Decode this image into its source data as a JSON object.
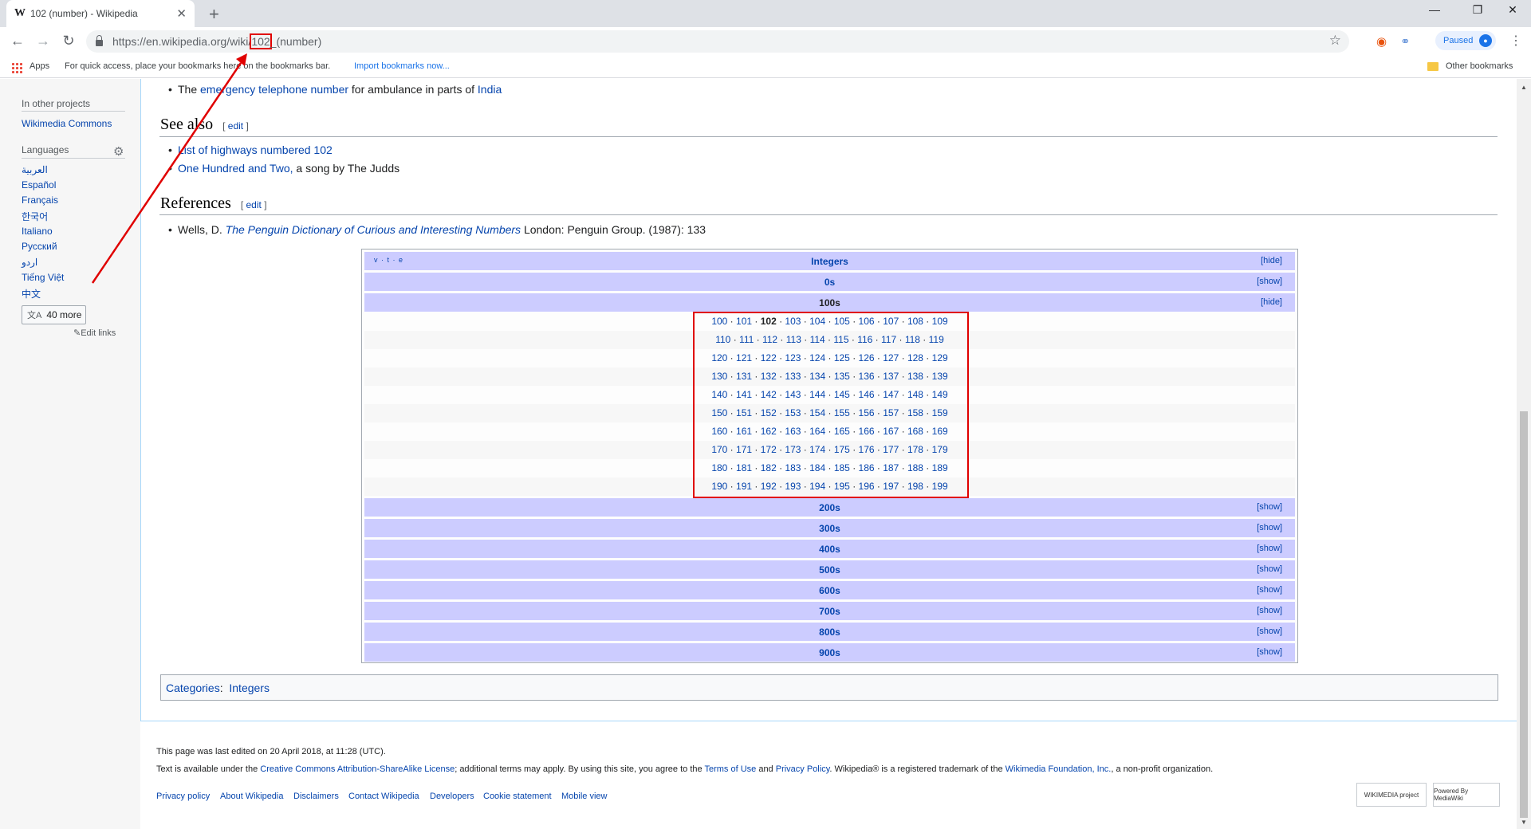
{
  "browser": {
    "tab_title": "102 (number) - Wikipedia",
    "tab_favicon": "W",
    "url_base": "https://en.wikipedia.org/wiki/",
    "url_highlight": "102",
    "url_rest": "_(number)",
    "profile_label": "Paused",
    "bookmarks": {
      "apps": "Apps",
      "hint": "For quick access, place your bookmarks here on the bookmarks bar.",
      "import": "Import bookmarks now...",
      "other": "Other bookmarks"
    },
    "accent_color": "#1a73e8"
  },
  "sidebar": {
    "other_projects_heading": "In other projects",
    "wikimedia_commons": "Wikimedia Commons",
    "languages_heading": "Languages",
    "languages": [
      "العربية",
      "Español",
      "Français",
      "한국어",
      "Italiano",
      "Русский",
      "اردو",
      "Tiếng Việt",
      "中文"
    ],
    "more_button": "40 more",
    "edit_links": "Edit links"
  },
  "article": {
    "top_line": {
      "prefix": "The ",
      "link1": "emergency telephone number",
      "middle": " for ambulance in parts of ",
      "link2": "India"
    },
    "see_also": {
      "heading": "See also",
      "edit": "edit",
      "items": [
        {
          "link": "List of highways numbered 102",
          "suffix": ""
        },
        {
          "link": "One Hundred and Two,",
          "suffix": " a song by The Judds"
        }
      ]
    },
    "references": {
      "heading": "References",
      "edit": "edit",
      "prefix": "Wells, D. ",
      "title_link": "The Penguin Dictionary of Curious and Interesting Numbers",
      "suffix": " London: Penguin Group. (1987): 133"
    }
  },
  "navbox": {
    "vte": "v · t · e",
    "title": "Integers",
    "hide": "[hide]",
    "show": "[show]",
    "groups_before": [
      "0s"
    ],
    "current_group": "100s",
    "current_number": "102",
    "rows": [
      [
        "100",
        "101",
        "102",
        "103",
        "104",
        "105",
        "106",
        "107",
        "108",
        "109"
      ],
      [
        "110",
        "111",
        "112",
        "113",
        "114",
        "115",
        "116",
        "117",
        "118",
        "119"
      ],
      [
        "120",
        "121",
        "122",
        "123",
        "124",
        "125",
        "126",
        "127",
        "128",
        "129"
      ],
      [
        "130",
        "131",
        "132",
        "133",
        "134",
        "135",
        "136",
        "137",
        "138",
        "139"
      ],
      [
        "140",
        "141",
        "142",
        "143",
        "144",
        "145",
        "146",
        "147",
        "148",
        "149"
      ],
      [
        "150",
        "151",
        "152",
        "153",
        "154",
        "155",
        "156",
        "157",
        "158",
        "159"
      ],
      [
        "160",
        "161",
        "162",
        "163",
        "164",
        "165",
        "166",
        "167",
        "168",
        "169"
      ],
      [
        "170",
        "171",
        "172",
        "173",
        "174",
        "175",
        "176",
        "177",
        "178",
        "179"
      ],
      [
        "180",
        "181",
        "182",
        "183",
        "184",
        "185",
        "186",
        "187",
        "188",
        "189"
      ],
      [
        "190",
        "191",
        "192",
        "193",
        "194",
        "195",
        "196",
        "197",
        "198",
        "199"
      ]
    ],
    "groups_after": [
      "200s",
      "300s",
      "400s",
      "500s",
      "600s",
      "700s",
      "800s",
      "900s"
    ]
  },
  "categories": {
    "label": "Categories",
    "items": [
      "Integers"
    ]
  },
  "footer": {
    "last_edited": "This page was last edited on 20 April 2018, at 11:28 (UTC).",
    "license_prefix": "Text is available under the ",
    "license_link": "Creative Commons Attribution-ShareAlike License",
    "license_mid1": "; additional terms may apply. By using this site, you agree to the ",
    "terms_link": "Terms of Use",
    "license_mid2": " and ",
    "privacy_link": "Privacy Policy",
    "license_mid3": ". Wikipedia® is a registered trademark of the ",
    "foundation_link": "Wikimedia Foundation, Inc.",
    "license_end": ", a non-profit organization.",
    "links": [
      "Privacy policy",
      "About Wikipedia",
      "Disclaimers",
      "Contact Wikipedia",
      "Developers",
      "Cookie statement",
      "Mobile view"
    ],
    "badge_wikimedia": "WIKIMEDIA project",
    "badge_mediawiki": "Powered By MediaWiki"
  },
  "annotation_color": "#e00000"
}
